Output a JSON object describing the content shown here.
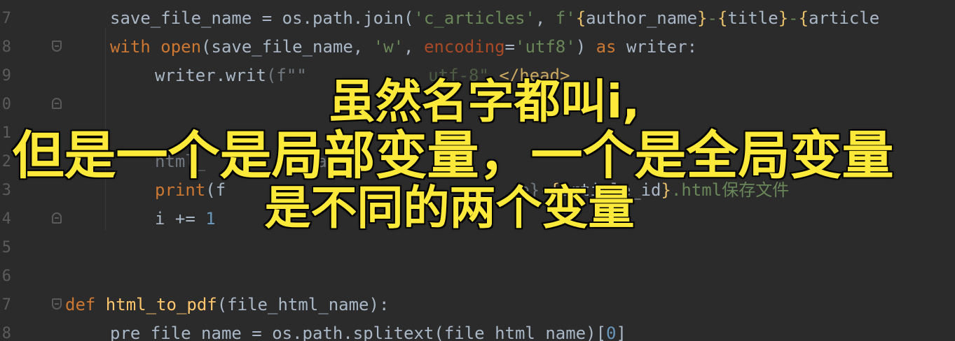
{
  "editor": {
    "line_numbers": [
      "7",
      "8",
      "9",
      "0",
      "1",
      "2",
      "3",
      "4",
      "5",
      "6",
      "7",
      "8"
    ],
    "lines": [
      {
        "indent": "",
        "tokens": [
          {
            "t": "save_file_name = os.path.join(",
            "c": ""
          },
          {
            "t": "'c_articles'",
            "c": "str"
          },
          {
            "t": ", ",
            "c": ""
          },
          {
            "t": "f'",
            "c": "str"
          },
          {
            "t": "{",
            "c": "br"
          },
          {
            "t": "author_name",
            "c": ""
          },
          {
            "t": "}",
            "c": "br"
          },
          {
            "t": "-",
            "c": "str"
          },
          {
            "t": "{",
            "c": "br"
          },
          {
            "t": "title",
            "c": ""
          },
          {
            "t": "}",
            "c": "br"
          },
          {
            "t": "-",
            "c": "str"
          },
          {
            "t": "{",
            "c": "br"
          },
          {
            "t": "article",
            "c": ""
          }
        ]
      },
      {
        "indent": "",
        "tokens": [
          {
            "t": "with ",
            "c": "kw"
          },
          {
            "t": "open",
            "c": "fn2"
          },
          {
            "t": "(save_file_name, ",
            "c": ""
          },
          {
            "t": "'w'",
            "c": "str"
          },
          {
            "t": ", ",
            "c": ""
          },
          {
            "t": "encoding",
            "c": "param"
          },
          {
            "t": "=",
            "c": ""
          },
          {
            "t": "'utf8'",
            "c": "str"
          },
          {
            "t": ") ",
            "c": ""
          },
          {
            "t": "as ",
            "c": "kw"
          },
          {
            "t": "writer:",
            "c": ""
          }
        ]
      },
      {
        "indent": "    ",
        "tokens": [
          {
            "t": "writer.writ",
            "c": ""
          },
          {
            "t": "(f\"",
            "c": "faded"
          },
          {
            "t": "\"",
            "c": "faded"
          },
          {
            "t": "          ",
            "c": ""
          },
          {
            "t": "  utf-8\" ",
            "c": "faded str"
          },
          {
            "t": "</head>",
            "c": "html"
          }
        ]
      },
      {
        "indent": "",
        "tokens": []
      },
      {
        "indent": "",
        "tokens": []
      },
      {
        "indent": "    ",
        "tokens": [
          {
            "t": "html_",
            "c": "faded"
          },
          {
            "t": "           ",
            "c": ""
          },
          {
            "t": "a",
            "c": "faded"
          }
        ]
      },
      {
        "indent": "    ",
        "tokens": [
          {
            "t": "print",
            "c": "fn2"
          },
          {
            "t": "(f",
            "c": ""
          },
          {
            "t": "                             ",
            "c": ""
          },
          {
            "t": "e}",
            "c": "faded"
          },
          {
            "t": "-",
            "c": "str"
          },
          {
            "t": "{",
            "c": "br"
          },
          {
            "t": "article_id",
            "c": ""
          },
          {
            "t": "}",
            "c": "br"
          },
          {
            "t": ".html保存文件",
            "c": "str"
          }
        ]
      },
      {
        "indent": "    ",
        "tokens": [
          {
            "t": "i += ",
            "c": ""
          },
          {
            "t": "1",
            "c": "num"
          }
        ]
      },
      {
        "indent": "",
        "tokens": []
      },
      {
        "indent": "",
        "tokens": []
      },
      {
        "indent": "",
        "tokens": [
          {
            "t": "def ",
            "c": "kw"
          },
          {
            "t": "html_to_pdf",
            "c": "fn"
          },
          {
            "t": "(file_html_name):",
            "c": ""
          }
        ],
        "outdent": true
      },
      {
        "indent": "",
        "tokens": [
          {
            "t": "pre_file_name = os.path.splitext(file_html_name)[",
            "c": ""
          },
          {
            "t": "0",
            "c": "num"
          },
          {
            "t": "]",
            "c": ""
          }
        ]
      }
    ],
    "fold_lines": [
      1,
      3,
      7,
      10
    ]
  },
  "subtitles": {
    "line1": "虽然名字都叫i,",
    "line2": "但是一个是局部变量，一个是全局变量",
    "line3": "是不同的两个变量"
  },
  "colors": {
    "background": "#2b2b2b",
    "keyword": "#cc7832",
    "function": "#ffc66d",
    "string": "#6a8759",
    "subtitle": "#fde93a"
  }
}
